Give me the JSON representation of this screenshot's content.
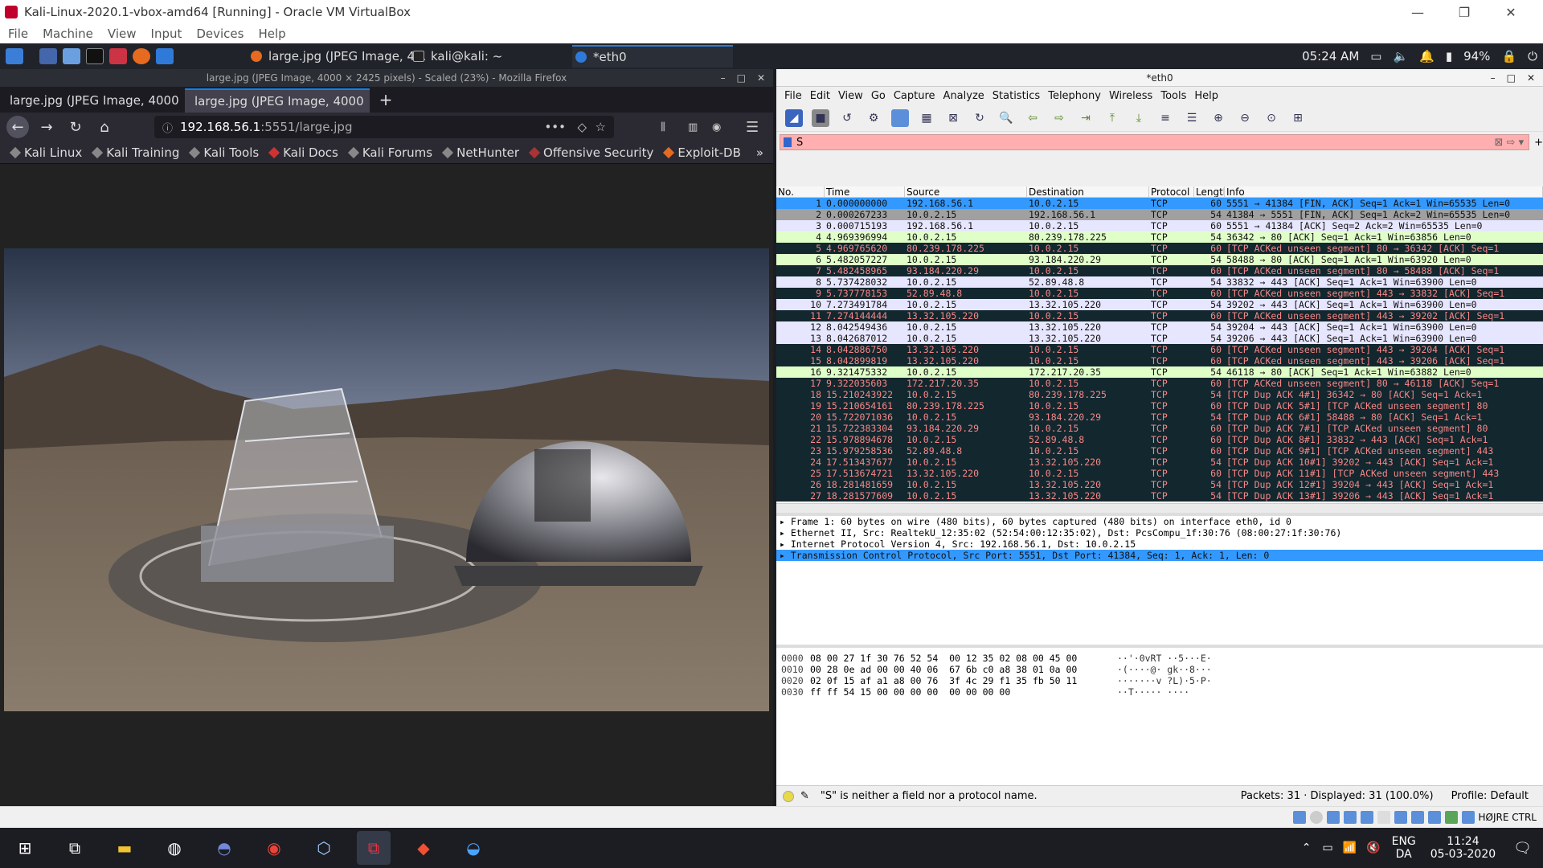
{
  "vbox": {
    "title": "Kali-Linux-2020.1-vbox-amd64 [Running] - Oracle VM VirtualBox",
    "menu": [
      "File",
      "Machine",
      "View",
      "Input",
      "Devices",
      "Help"
    ],
    "hostkey": "HØJRE CTRL"
  },
  "kali_panel": {
    "tasks": [
      "large.jpg (JPEG Image, 4...",
      "kali@kali: ~",
      "*eth0"
    ],
    "time": "05:24 AM",
    "battery": "94%"
  },
  "firefox": {
    "window_title": "large.jpg (JPEG Image, 4000 × 2425 pixels) - Scaled (23%) - Mozilla Firefox",
    "tabs": [
      "large.jpg (JPEG Image, 4000",
      "large.jpg (JPEG Image, 4000"
    ],
    "url_host": "192.168.56.1",
    "url_path": ":5551/large.jpg",
    "bookmarks": [
      "Kali Linux",
      "Kali Training",
      "Kali Tools",
      "Kali Docs",
      "Kali Forums",
      "NetHunter",
      "Offensive Security",
      "Exploit-DB"
    ]
  },
  "wireshark": {
    "title": "*eth0",
    "menu": [
      "File",
      "Edit",
      "View",
      "Go",
      "Capture",
      "Analyze",
      "Statistics",
      "Telephony",
      "Wireless",
      "Tools",
      "Help"
    ],
    "filter_value": "S",
    "columns": [
      "No.",
      "Time",
      "Source",
      "Destination",
      "Protocol",
      "Length",
      "Info"
    ],
    "packets": [
      [
        "1",
        "0.000000000",
        "192.168.56.1",
        "10.0.2.15",
        "TCP",
        "60",
        "5551 → 41384 [FIN, ACK] Seq=1 Ack=1 Win=65535 Len=0",
        "sel"
      ],
      [
        "2",
        "0.000267233",
        "10.0.2.15",
        "192.168.56.1",
        "TCP",
        "54",
        "41384 → 5551 [FIN, ACK] Seq=1 Ack=2 Win=65535 Len=0",
        "gray"
      ],
      [
        "3",
        "0.000715193",
        "192.168.56.1",
        "10.0.2.15",
        "TCP",
        "60",
        "5551 → 41384 [ACK] Seq=2 Ack=2 Win=65535 Len=0",
        "lav"
      ],
      [
        "4",
        "4.969396994",
        "10.0.2.15",
        "80.239.178.225",
        "TCP",
        "54",
        "36342 → 80 [ACK] Seq=1 Ack=1 Win=63856 Len=0",
        "green"
      ],
      [
        "5",
        "4.969765620",
        "80.239.178.225",
        "10.0.2.15",
        "TCP",
        "60",
        "[TCP ACKed unseen segment] 80 → 36342 [ACK] Seq=1",
        "bad"
      ],
      [
        "6",
        "5.482057227",
        "10.0.2.15",
        "93.184.220.29",
        "TCP",
        "54",
        "58488 → 80 [ACK] Seq=1 Ack=1 Win=63920 Len=0",
        "green"
      ],
      [
        "7",
        "5.482458965",
        "93.184.220.29",
        "10.0.2.15",
        "TCP",
        "60",
        "[TCP ACKed unseen segment] 80 → 58488 [ACK] Seq=1",
        "bad"
      ],
      [
        "8",
        "5.737428032",
        "10.0.2.15",
        "52.89.48.8",
        "TCP",
        "54",
        "33832 → 443 [ACK] Seq=1 Ack=1 Win=63900 Len=0",
        "lav"
      ],
      [
        "9",
        "5.737778153",
        "52.89.48.8",
        "10.0.2.15",
        "TCP",
        "60",
        "[TCP ACKed unseen segment] 443 → 33832 [ACK] Seq=1",
        "bad"
      ],
      [
        "10",
        "7.273491784",
        "10.0.2.15",
        "13.32.105.220",
        "TCP",
        "54",
        "39202 → 443 [ACK] Seq=1 Ack=1 Win=63900 Len=0",
        "lav"
      ],
      [
        "11",
        "7.274144444",
        "13.32.105.220",
        "10.0.2.15",
        "TCP",
        "60",
        "[TCP ACKed unseen segment] 443 → 39202 [ACK] Seq=1",
        "bad"
      ],
      [
        "12",
        "8.042549436",
        "10.0.2.15",
        "13.32.105.220",
        "TCP",
        "54",
        "39204 → 443 [ACK] Seq=1 Ack=1 Win=63900 Len=0",
        "lav"
      ],
      [
        "13",
        "8.042687012",
        "10.0.2.15",
        "13.32.105.220",
        "TCP",
        "54",
        "39206 → 443 [ACK] Seq=1 Ack=1 Win=63900 Len=0",
        "lav"
      ],
      [
        "14",
        "8.042886750",
        "13.32.105.220",
        "10.0.2.15",
        "TCP",
        "60",
        "[TCP ACKed unseen segment] 443 → 39204 [ACK] Seq=1",
        "bad"
      ],
      [
        "15",
        "8.042899819",
        "13.32.105.220",
        "10.0.2.15",
        "TCP",
        "60",
        "[TCP ACKed unseen segment] 443 → 39206 [ACK] Seq=1",
        "bad"
      ],
      [
        "16",
        "9.321475332",
        "10.0.2.15",
        "172.217.20.35",
        "TCP",
        "54",
        "46118 → 80 [ACK] Seq=1 Ack=1 Win=63882 Len=0",
        "green"
      ],
      [
        "17",
        "9.322035603",
        "172.217.20.35",
        "10.0.2.15",
        "TCP",
        "60",
        "[TCP ACKed unseen segment] 80 → 46118 [ACK] Seq=1",
        "bad"
      ],
      [
        "18",
        "15.210243922",
        "10.0.2.15",
        "80.239.178.225",
        "TCP",
        "54",
        "[TCP Dup ACK 4#1] 36342 → 80 [ACK] Seq=1 Ack=1",
        "bad"
      ],
      [
        "19",
        "15.210654161",
        "80.239.178.225",
        "10.0.2.15",
        "TCP",
        "60",
        "[TCP Dup ACK 5#1] [TCP ACKed unseen segment] 80",
        "bad"
      ],
      [
        "20",
        "15.722071036",
        "10.0.2.15",
        "93.184.220.29",
        "TCP",
        "54",
        "[TCP Dup ACK 6#1] 58488 → 80 [ACK] Seq=1 Ack=1",
        "bad"
      ],
      [
        "21",
        "15.722383304",
        "93.184.220.29",
        "10.0.2.15",
        "TCP",
        "60",
        "[TCP Dup ACK 7#1] [TCP ACKed unseen segment] 80",
        "bad"
      ],
      [
        "22",
        "15.978894678",
        "10.0.2.15",
        "52.89.48.8",
        "TCP",
        "60",
        "[TCP Dup ACK 8#1] 33832 → 443 [ACK] Seq=1 Ack=1",
        "bad"
      ],
      [
        "23",
        "15.979258536",
        "52.89.48.8",
        "10.0.2.15",
        "TCP",
        "60",
        "[TCP Dup ACK 9#1] [TCP ACKed unseen segment] 443",
        "bad"
      ],
      [
        "24",
        "17.513437677",
        "10.0.2.15",
        "13.32.105.220",
        "TCP",
        "54",
        "[TCP Dup ACK 10#1] 39202 → 443 [ACK] Seq=1 Ack=1",
        "bad"
      ],
      [
        "25",
        "17.513674721",
        "13.32.105.220",
        "10.0.2.15",
        "TCP",
        "60",
        "[TCP Dup ACK 11#1] [TCP ACKed unseen segment] 443",
        "bad"
      ],
      [
        "26",
        "18.281481659",
        "10.0.2.15",
        "13.32.105.220",
        "TCP",
        "54",
        "[TCP Dup ACK 12#1] 39204 → 443 [ACK] Seq=1 Ack=1",
        "bad"
      ],
      [
        "27",
        "18.281577609",
        "10.0.2.15",
        "13.32.105.220",
        "TCP",
        "54",
        "[TCP Dup ACK 13#1] 39206 → 443 [ACK] Seq=1 Ack=1",
        "bad"
      ]
    ],
    "details": [
      "Frame 1: 60 bytes on wire (480 bits), 60 bytes captured (480 bits) on interface eth0, id 0",
      "Ethernet II, Src: RealtekU_12:35:02 (52:54:00:12:35:02), Dst: PcsCompu_1f:30:76 (08:00:27:1f:30:76)",
      "Internet Protocol Version 4, Src: 192.168.56.1, Dst: 10.0.2.15",
      "Transmission Control Protocol, Src Port: 5551, Dst Port: 41384, Seq: 1, Ack: 1, Len: 0"
    ],
    "bytes": [
      [
        "0000",
        "08 00 27 1f 30 76 52 54  00 12 35 02 08 00 45 00",
        "··'·0vRT ··5···E·"
      ],
      [
        "0010",
        "00 28 0e ad 00 00 40 06  67 6b c0 a8 38 01 0a 00",
        "·(····@· gk··8···"
      ],
      [
        "0020",
        "02 0f 15 af a1 a8 00 76  3f 4c 29 f1 35 fb 50 11",
        "·······v ?L)·5·P·"
      ],
      [
        "0030",
        "ff ff 54 15 00 00 00 00  00 00 00 00",
        "··T····· ····"
      ]
    ],
    "status_msg": "\"S\" is neither a field nor a protocol name.",
    "packets_info": "Packets: 31 · Displayed: 31 (100.0%)",
    "profile": "Profile: Default"
  },
  "windows": {
    "lang1": "ENG",
    "lang2": "DA",
    "time": "11:24",
    "date": "05-03-2020"
  },
  "colors": {
    "sel": "#3399ff",
    "bad": "#12272e",
    "bad_fg": "#f78787",
    "green": "#e0ffc8",
    "lav": "#e7e6ff",
    "gray": "#a0a0a0"
  }
}
